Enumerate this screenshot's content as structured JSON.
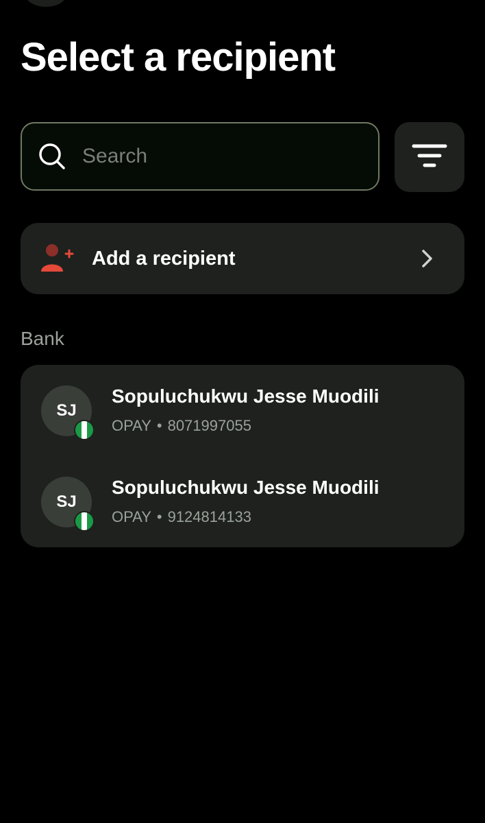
{
  "header": {
    "title": "Select a recipient"
  },
  "search": {
    "placeholder": "Search"
  },
  "add_recipient": {
    "label": "Add a recipient"
  },
  "section": {
    "label": "Bank"
  },
  "recipients": [
    {
      "initials": "SJ",
      "name": "Sopuluchukwu Jesse Muodili",
      "bank": "OPAY",
      "separator": "•",
      "account": "8071997055"
    },
    {
      "initials": "SJ",
      "name": "Sopuluchukwu Jesse Muodili",
      "bank": "OPAY",
      "separator": "•",
      "account": "9124814133"
    }
  ],
  "colors": {
    "background": "#000000",
    "card": "#1e211e",
    "accent_red": "#e5493a",
    "flag_green": "#1a9a46",
    "search_border": "#6e7a63"
  },
  "icons": {
    "search": "search-icon",
    "filter": "filter-icon",
    "add_user": "add-user-icon",
    "chevron": "chevron-right-icon",
    "flag": "nigeria-flag-icon"
  }
}
